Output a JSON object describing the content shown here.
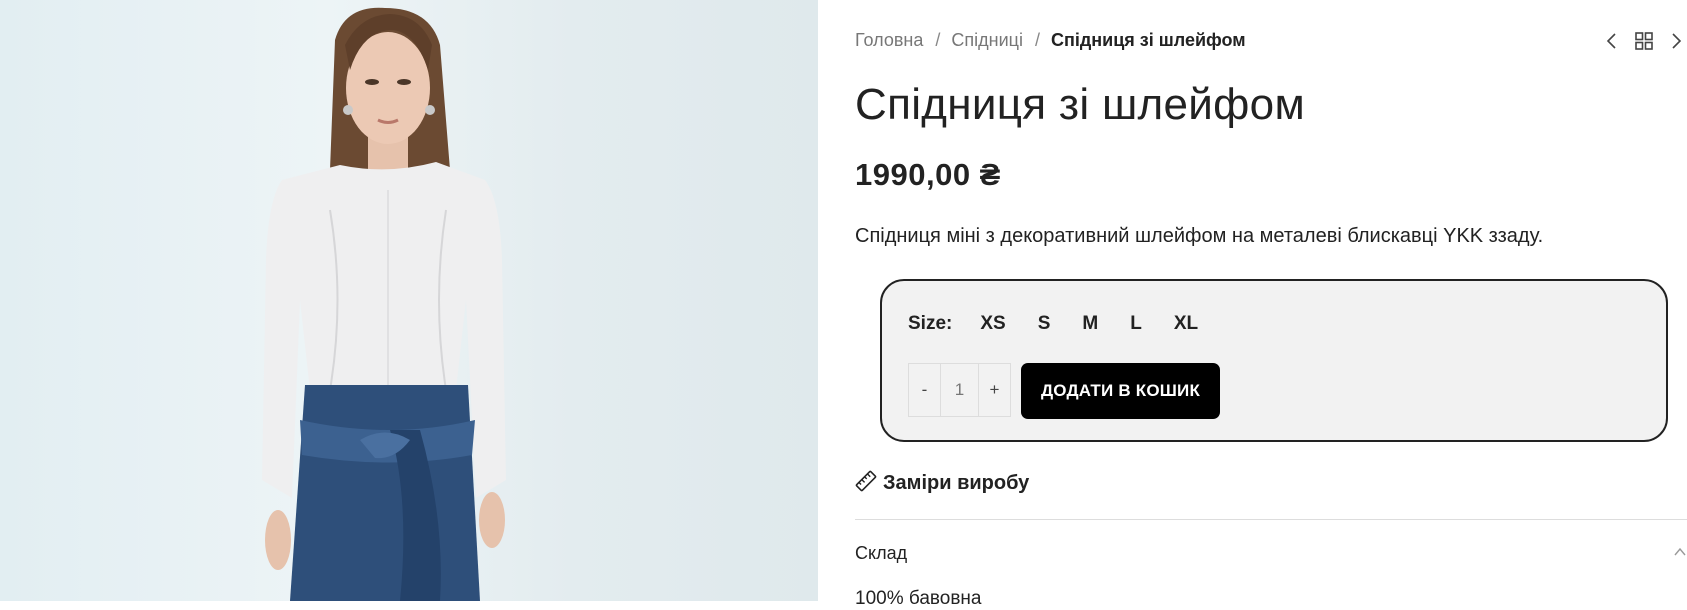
{
  "breadcrumb": {
    "home": "Головна",
    "category": "Спідниці",
    "current": "Спідниця зі шлейфом",
    "separator": "/"
  },
  "product": {
    "title": "Спідниця зі шлейфом",
    "price": "1990,00 ₴",
    "description": "Спідниця міні з декоративний шлейфом на металеві блискавці YKK ззаду."
  },
  "sizes": {
    "label": "Size",
    "options": [
      "XS",
      "S",
      "M",
      "L",
      "XL"
    ]
  },
  "quantity": {
    "minus": "-",
    "value": "1",
    "plus": "+"
  },
  "add_to_cart": "ДОДАТИ В КОШИК",
  "measurements": "Заміри виробу",
  "composition": {
    "title": "Склад",
    "value": "100% бавовна"
  },
  "colors": {
    "accent": "#000000",
    "text": "#222222",
    "muted": "#777777",
    "box_bg": "#f2f2f2"
  }
}
